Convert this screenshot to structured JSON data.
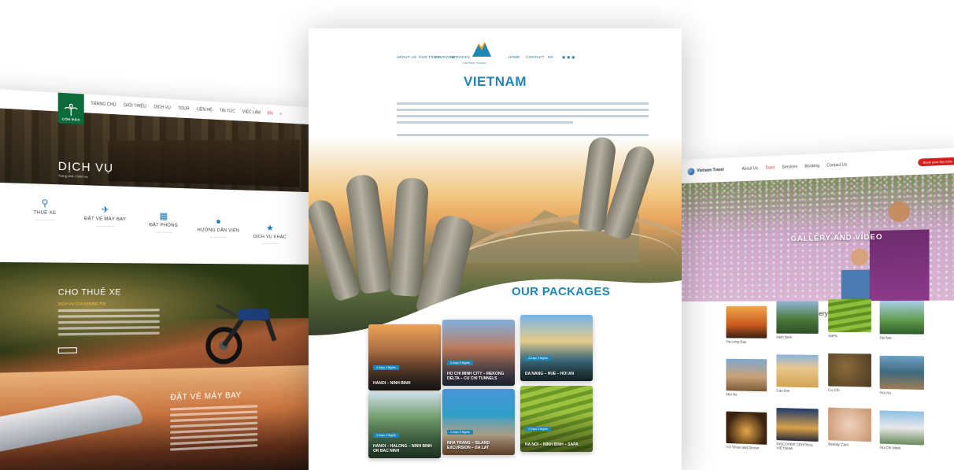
{
  "left_site": {
    "logo": "CÔN ĐẢO",
    "nav": [
      "TRANG CHỦ",
      "GIỚI THIỆU",
      "DỊCH VỤ",
      "TOUR",
      "LIÊN HỆ",
      "TIN TỨC",
      "VIỆC LÀM",
      "EN"
    ],
    "hero_title": "DỊCH VỤ",
    "hero_crumb": "Trang chủ / Dịch vụ",
    "services": [
      {
        "label": "THUÊ XE",
        "icon": "motorbike-icon"
      },
      {
        "label": "ĐẶT VÉ MÁY BAY",
        "icon": "plane-icon"
      },
      {
        "label": "ĐẶT PHÒNG",
        "icon": "building-icon"
      },
      {
        "label": "HƯỚNG DẪN VIÊN",
        "icon": "person-icon"
      },
      {
        "label": "DỊCH VỤ KHÁC",
        "icon": "star-icon"
      }
    ],
    "band1_title": "CHO THUÊ XE",
    "band1_subtitle": "DỊCH VỤ CỦA CHÚNG TÔI",
    "band2_title": "ĐẶT VÉ MÁY BAY",
    "colors": {
      "accent": "#1e7ab2",
      "logo_bg": "#0b6b3a"
    }
  },
  "center_site": {
    "nav_left": [
      "ABOUT US",
      "OUR TRIPS",
      "OVERVIEW",
      "SERVICES"
    ],
    "nav_right": [
      "HOME",
      "CONTACT",
      "EN"
    ],
    "logo_text": "VIETNAM TRAVEL",
    "title": "VIETNAM",
    "section_title": "OUR PACKAGES",
    "packages": [
      {
        "tag": "4 Days 3 Nights",
        "name": "HANOI – NINH BINH"
      },
      {
        "tag": "4 Days 3 Nights",
        "name": "HO CHI MINH CITY – MEKONG DELTA – CU CHI TUNNELS"
      },
      {
        "tag": "4 Days 3 Nights",
        "name": "DA NANG – HUE – HOI AN"
      },
      {
        "tag": "4 Days 3 Nights",
        "name": "HANOI – HALONG – NINH BINH OR BAC NINH"
      },
      {
        "tag": "4 Days 3 Nights",
        "name": "NHA TRANG – ISLAND EXCURSION – DA LAT"
      },
      {
        "tag": "4 Days 3 Nights",
        "name": "HA NOI – NINH BINH – SAPA"
      }
    ],
    "colors": {
      "accent": "#1f86b5"
    }
  },
  "right_site": {
    "logo": "Vietnam Travel",
    "nav": [
      "About Us",
      "Tours",
      "Services",
      "Booking",
      "Contact Us"
    ],
    "cta": "Book your trip now",
    "hero_title": "GALLERY AND VIDEO",
    "gallery_title": "Gallery",
    "gallery": [
      "Ha Long Bay",
      "Ninh Binh",
      "SaPa",
      "Ha Noi",
      "Mui Ne",
      "Cao Dai",
      "Cu Chi",
      "Hoi An",
      "AO Show and Dinner",
      "DISCOVER CENTRAL VIETNAM",
      "Beauty Care",
      "Ho Chi Minh"
    ],
    "colors": {
      "cta": "#d11f1f"
    }
  }
}
